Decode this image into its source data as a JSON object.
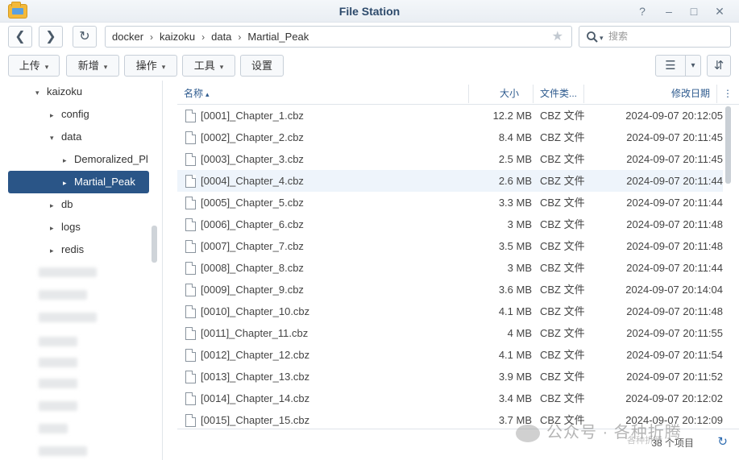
{
  "window": {
    "title": "File Station",
    "help": "?",
    "minimize": "–",
    "maximize": "□",
    "close": "✕"
  },
  "nav": {
    "back": "❮",
    "forward": "❯",
    "refresh": "↻",
    "path": [
      "docker",
      "kaizoku",
      "data",
      "Martial_Peak"
    ],
    "path_separator": "›",
    "bookmark": "★",
    "search_placeholder": "搜索",
    "search_icon": "search-icon"
  },
  "toolbar": {
    "upload_label": "上传",
    "create_label": "新增",
    "action_label": "操作",
    "tools_label": "工具",
    "settings_label": "设置",
    "caret": "▾",
    "view_list_icon": "☰",
    "view_dropdown_icon": "▾",
    "sort_icon": "⇵"
  },
  "sidebar": {
    "items": [
      {
        "label": "kaizoku",
        "arrow": "▾",
        "level": 1
      },
      {
        "label": "config",
        "arrow": "▸",
        "level": 2
      },
      {
        "label": "data",
        "arrow": "▾",
        "level": 2
      },
      {
        "label": "Demoralized_Pl",
        "arrow": "▸",
        "level": 3
      },
      {
        "label": "Martial_Peak",
        "arrow": "▸",
        "level": 3,
        "selected": true
      },
      {
        "label": "db",
        "arrow": "▸",
        "level": 2
      },
      {
        "label": "logs",
        "arrow": "▸",
        "level": 2
      },
      {
        "label": "redis",
        "arrow": "▸",
        "level": 2
      }
    ]
  },
  "table": {
    "headers": {
      "name": "名称",
      "name_sort": "▴",
      "size": "大小",
      "type": "文件类...",
      "date": "修改日期",
      "more": "⋮"
    },
    "rows": [
      {
        "name": "[0001]_Chapter_1.cbz",
        "size": "12.2 MB",
        "type": "CBZ 文件",
        "date": "2024-09-07 20:12:05"
      },
      {
        "name": "[0002]_Chapter_2.cbz",
        "size": "8.4 MB",
        "type": "CBZ 文件",
        "date": "2024-09-07 20:11:45"
      },
      {
        "name": "[0003]_Chapter_3.cbz",
        "size": "2.5 MB",
        "type": "CBZ 文件",
        "date": "2024-09-07 20:11:45"
      },
      {
        "name": "[0004]_Chapter_4.cbz",
        "size": "2.6 MB",
        "type": "CBZ 文件",
        "date": "2024-09-07 20:11:44"
      },
      {
        "name": "[0005]_Chapter_5.cbz",
        "size": "3.3 MB",
        "type": "CBZ 文件",
        "date": "2024-09-07 20:11:44"
      },
      {
        "name": "[0006]_Chapter_6.cbz",
        "size": "3 MB",
        "type": "CBZ 文件",
        "date": "2024-09-07 20:11:48"
      },
      {
        "name": "[0007]_Chapter_7.cbz",
        "size": "3.5 MB",
        "type": "CBZ 文件",
        "date": "2024-09-07 20:11:48"
      },
      {
        "name": "[0008]_Chapter_8.cbz",
        "size": "3 MB",
        "type": "CBZ 文件",
        "date": "2024-09-07 20:11:44"
      },
      {
        "name": "[0009]_Chapter_9.cbz",
        "size": "3.6 MB",
        "type": "CBZ 文件",
        "date": "2024-09-07 20:14:04"
      },
      {
        "name": "[0010]_Chapter_10.cbz",
        "size": "4.1 MB",
        "type": "CBZ 文件",
        "date": "2024-09-07 20:11:48"
      },
      {
        "name": "[0011]_Chapter_11.cbz",
        "size": "4 MB",
        "type": "CBZ 文件",
        "date": "2024-09-07 20:11:55"
      },
      {
        "name": "[0012]_Chapter_12.cbz",
        "size": "4.1 MB",
        "type": "CBZ 文件",
        "date": "2024-09-07 20:11:54"
      },
      {
        "name": "[0013]_Chapter_13.cbz",
        "size": "3.9 MB",
        "type": "CBZ 文件",
        "date": "2024-09-07 20:11:52"
      },
      {
        "name": "[0014]_Chapter_14.cbz",
        "size": "3.4 MB",
        "type": "CBZ 文件",
        "date": "2024-09-07 20:12:02"
      },
      {
        "name": "[0015]_Chapter_15.cbz",
        "size": "3.7 MB",
        "type": "CBZ 文件",
        "date": "2024-09-07 20:12:09"
      }
    ]
  },
  "footer": {
    "count": "38 个项目",
    "refresh_icon": "↻"
  },
  "watermark": {
    "text": "公众号 · 各种折腾",
    "sub": "各种折腾"
  },
  "colors": {
    "selected_bg": "#2a5587",
    "header_text": "#2d5a8e",
    "hover_row": "#eef4fb"
  }
}
